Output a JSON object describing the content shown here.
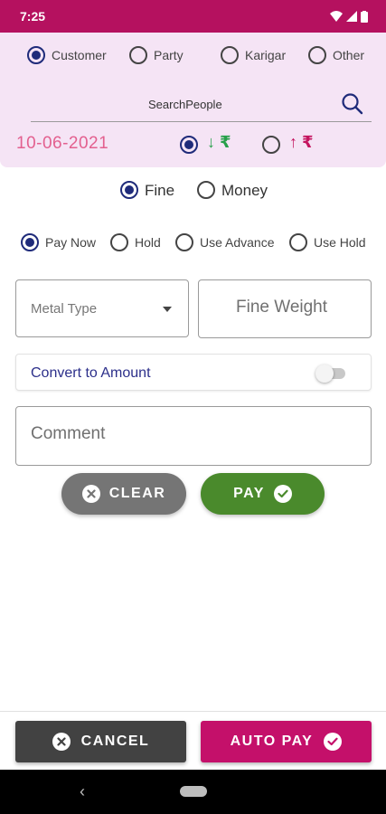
{
  "status": {
    "time": "7:25"
  },
  "people_type": {
    "options": [
      "Customer",
      "Party",
      "Karigar",
      "Other"
    ],
    "selected": "Customer"
  },
  "search": {
    "placeholder": "SearchPeople"
  },
  "date": "10-06-2021",
  "direction": {
    "in_label": "↓ ₹",
    "out_label": "↑ ₹",
    "selected": "in",
    "in_color": "#27a04a",
    "out_color": "#c4155f"
  },
  "mode": {
    "options": [
      "Fine",
      "Money"
    ],
    "selected": "Fine"
  },
  "payment_option": {
    "options": [
      "Pay Now",
      "Hold",
      "Use Advance",
      "Use Hold"
    ],
    "selected": "Pay Now"
  },
  "metal_type": {
    "placeholder": "Metal Type"
  },
  "fine_weight": {
    "placeholder": "Fine Weight"
  },
  "convert": {
    "label": "Convert to Amount",
    "enabled": false
  },
  "comment": {
    "placeholder": "Comment"
  },
  "actions": {
    "clear_label": "CLEAR",
    "pay_label": "PAY"
  },
  "footer": {
    "cancel_label": "CANCEL",
    "auto_pay_label": "AUTO PAY"
  },
  "colors": {
    "brand": "#b5115f",
    "header_bg": "#f5e4f5",
    "radio_accent": "#1f2b7a",
    "date_text": "#e3608f",
    "clear_bg": "#757575",
    "pay_bg": "#4a8a2c",
    "cancel_bg": "#424242",
    "auto_pay_bg": "#c4106a",
    "convert_text": "#2c2f8a"
  }
}
